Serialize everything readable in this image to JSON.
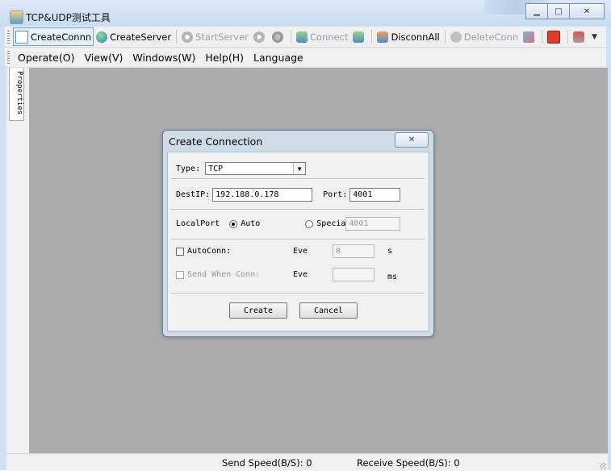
{
  "window": {
    "title": "TCP&UDP测试工具"
  },
  "toolbar": {
    "create_conn": "CreateConnn",
    "create_server": "CreateServer",
    "start_server": "StartServer",
    "connect": "Connect",
    "disconn_all": "DisconnAll",
    "delete_conn": "DeleteConn"
  },
  "menu": {
    "operate": "Operate(O)",
    "view": "View(V)",
    "windows": "Windows(W)",
    "help": "Help(H)",
    "language": "Language"
  },
  "side_tab": {
    "label": "Properties"
  },
  "dialog": {
    "title": "Create Connection",
    "type_label": "Type:",
    "type_value": "TCP",
    "destip_label": "DestIP:",
    "destip_value": "192.188.0.178",
    "port_label": "Port:",
    "port_value": "4001",
    "localport_label": "LocalPort",
    "auto_label": "Auto",
    "specia_label": "Specia",
    "specia_value": "4001",
    "autoconn_label": "AutoConn:",
    "eve_label_1": "Eve",
    "eve_value_1": "0",
    "unit_s": "s",
    "send_when_conn_label": "Send When Conn:",
    "eve_label_2": "Eve",
    "eve_value_2": "",
    "unit_ms": "ms",
    "create_button": "Create",
    "cancel_button": "Cancel"
  },
  "status": {
    "send_speed": "Send Speed(B/S): 0",
    "receive_speed": "Receive Speed(B/S): 0"
  }
}
